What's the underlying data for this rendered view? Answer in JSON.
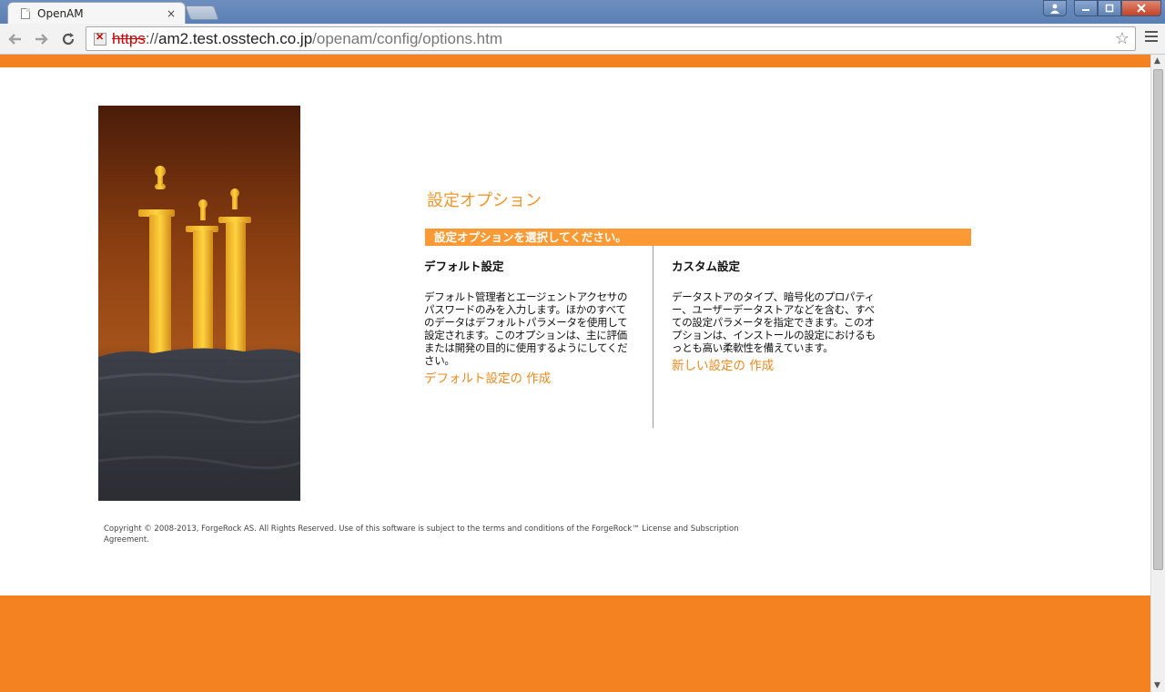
{
  "browser": {
    "tab_title": "OpenAM",
    "tab_close": "×",
    "url_scheme": "https",
    "url_sep": "://",
    "url_host": "am2.test.osstech.co.jp",
    "url_path": "/openam/config/options.htm"
  },
  "page": {
    "title": "設定オプション",
    "select_prompt": "設定オプションを選択してください。",
    "default_option": {
      "heading": "デフォルト設定",
      "description": "デフォルト管理者とエージェントアクセサのパスワードのみを入力します。ほかのすべてのデータはデフォルトパラメータを使用して設定されます。このオプションは、主に評価または開発の目的に使用するようにしてください。",
      "link": "デフォルト設定の 作成"
    },
    "custom_option": {
      "heading": "カスタム設定",
      "description": "データストアのタイプ、暗号化のプロパティー、ユーザーデータストアなどを含む、すべての設定パラメータを指定できます。このオプションは、インストールの設定におけるもっとも高い柔軟性を備えています。",
      "link": "新しい設定の 作成"
    },
    "copyright": "Copyright © 2008-2013, ForgeRock AS. All Rights Reserved. Use of this software is subject to the terms and conditions of the ForgeRock™ License and Subscription Agreement."
  },
  "colors": {
    "brand_orange": "#f58220",
    "bar_orange": "#fb9a34",
    "link_orange": "#e98a1e"
  }
}
